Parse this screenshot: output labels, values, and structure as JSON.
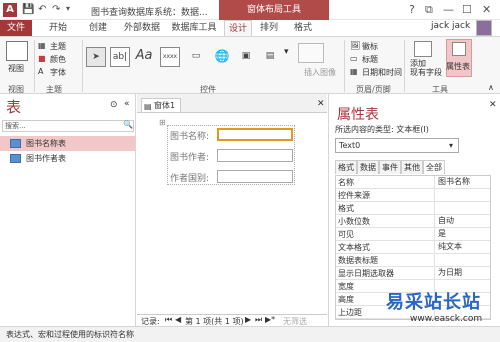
{
  "title_bar": {
    "app_icon": "A",
    "title": "图书查询数据库系统：数据...",
    "tool_context": "窗体布局工具",
    "buttons": {
      "help": "?",
      "restore": "⧉",
      "minimize": "—",
      "maximize": "☐",
      "close": "✕"
    }
  },
  "tabs": [
    "文件",
    "开始",
    "创建",
    "外部数据",
    "数据库工具",
    "设计",
    "排列",
    "格式"
  ],
  "active_tab": "设计",
  "user": "jack jack",
  "ribbon": {
    "views": {
      "label": "视图",
      "group": "视图"
    },
    "theme": {
      "items": [
        "主题",
        "颜色",
        "字体"
      ],
      "group": "主题"
    },
    "controls": {
      "group": "控件",
      "insert_image": "插入图像"
    },
    "header_footer": {
      "items": [
        "徽标",
        "标题",
        "日期和时间"
      ],
      "group": "页眉/页脚"
    },
    "tools": {
      "add_fields": "添加\n现有字段",
      "property_sheet": "属性表",
      "group": "工具"
    }
  },
  "nav": {
    "title": "表",
    "search_placeholder": "搜索...",
    "items": [
      "图书名称表",
      "图书作者表"
    ]
  },
  "form": {
    "doc_tab": "窗体1",
    "fields": [
      {
        "label": "图书名称:"
      },
      {
        "label": "图书作者:"
      },
      {
        "label": "作者国别:"
      }
    ],
    "record_nav": {
      "prefix": "记录:",
      "position": "第 1 项(共 1 项)",
      "filter": "无筛选"
    }
  },
  "props": {
    "title": "属性表",
    "selection_type": "所选内容的类型: 文本框(I)",
    "selected_control": "Text0",
    "tabs": [
      "格式",
      "数据",
      "事件",
      "其他",
      "全部"
    ],
    "active_tab": "全部",
    "rows": [
      {
        "name": "名称",
        "value": "图书名称"
      },
      {
        "name": "控件来源",
        "value": ""
      },
      {
        "name": "格式",
        "value": ""
      },
      {
        "name": "小数位数",
        "value": "自动"
      },
      {
        "name": "可见",
        "value": "是"
      },
      {
        "name": "文本格式",
        "value": "纯文本"
      },
      {
        "name": "数据表标题",
        "value": ""
      },
      {
        "name": "显示日期选取器",
        "value": "为日期"
      },
      {
        "name": "宽度",
        "value": ""
      },
      {
        "name": "高度",
        "value": ""
      },
      {
        "name": "上边距",
        "value": ""
      }
    ]
  },
  "status": "表达式、宏和过程使用的标识符名称",
  "watermark": {
    "brand": "易采站长站",
    "url": "www.easck.com"
  },
  "colors": {
    "accent": "#a4373a",
    "tool_context": "#b14b49"
  }
}
